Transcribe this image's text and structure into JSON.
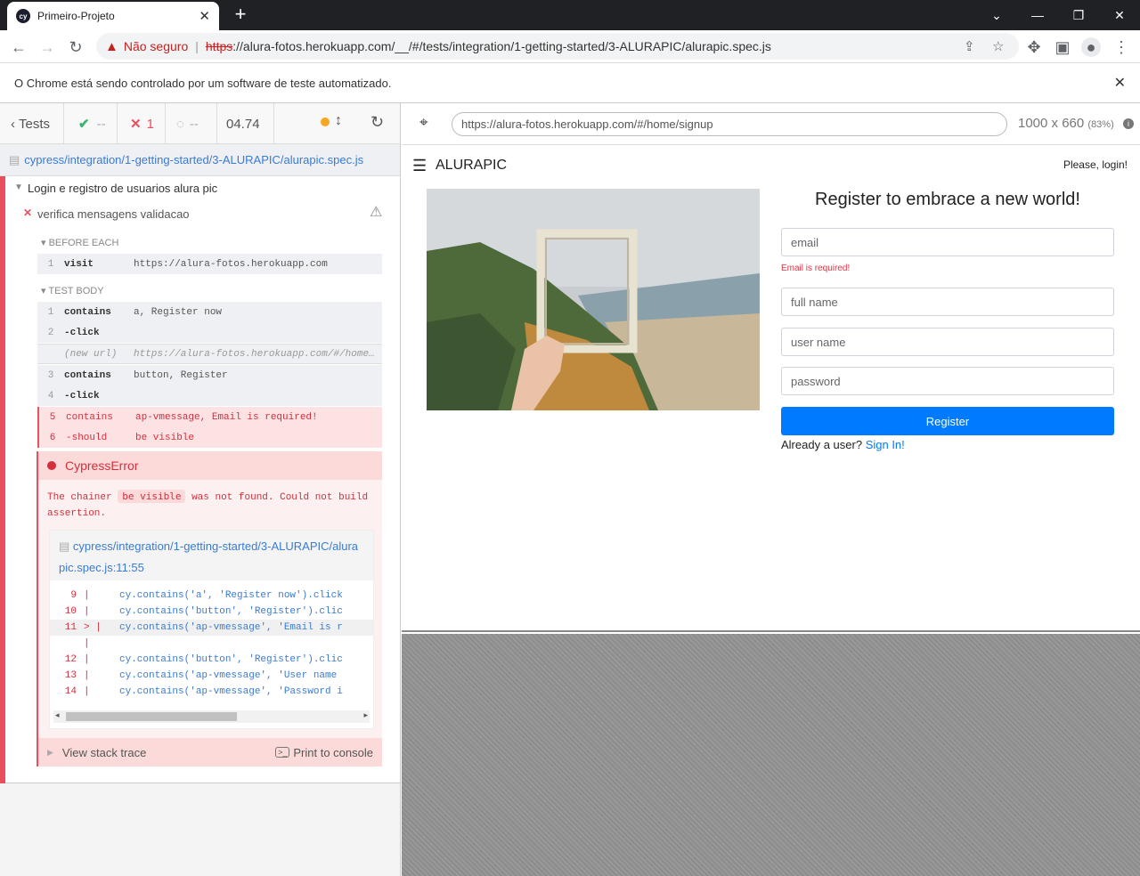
{
  "browser": {
    "tab_title": "Primeiro-Projeto",
    "favicon_text": "cy",
    "not_secure_label": "Não seguro",
    "url_scheme": "https",
    "url_rest": "://alura-fotos.herokuapp.com/__/#/tests/integration/1-getting-started/3-ALURAPIC/alurapic.spec.js",
    "infobar_text": "O Chrome está sendo controlado por um software de teste automatizado."
  },
  "reporter": {
    "tests_label": "Tests",
    "passed": "--",
    "failed": "1",
    "pending": "--",
    "duration": "04.74",
    "spec_path": "cypress/integration/1-getting-started/3-ALURAPIC/alurapic.spec.js",
    "suite_title": "Login e registro de usuarios alura pic",
    "test_title": "verifica mensagens validacao",
    "before_each_label": "BEFORE EACH",
    "test_body_label": "TEST BODY",
    "before_each_commands": [
      {
        "n": "1",
        "name": "visit",
        "msg": "https://alura-fotos.herokuapp.com"
      }
    ],
    "commands": [
      {
        "n": "1",
        "name": "contains",
        "msg": "a, Register now"
      },
      {
        "n": "2",
        "name": "-click",
        "msg": ""
      },
      {
        "n": "",
        "name": "(new url)",
        "msg": "https://alura-fotos.herokuapp.com/#/home/signup"
      },
      {
        "n": "3",
        "name": "contains",
        "msg": "button, Register"
      },
      {
        "n": "4",
        "name": "-click",
        "msg": ""
      },
      {
        "n": "5",
        "name": "contains",
        "msg": "ap-vmessage, Email is required!"
      },
      {
        "n": "6",
        "name": "-should",
        "msg": "be visible"
      }
    ],
    "error": {
      "title": "CypressError",
      "message_pre": "The chainer",
      "message_code": "be visible",
      "message_post": "was not found. Could not build assertion.",
      "file_link": "cypress/integration/1-getting-started/3-ALURAPIC/alurapic.spec.js:11:55",
      "code_lines": [
        {
          "ln": "9",
          "marker": "|",
          "code": "cy.contains('a', 'Register now').click"
        },
        {
          "ln": "10",
          "marker": "|",
          "code": "cy.contains('button', 'Register').clic"
        },
        {
          "ln": "11",
          "marker": "> |",
          "code": "cy.contains('ap-vmessage', 'Email is r"
        },
        {
          "ln": "",
          "marker": "|",
          "code": ""
        },
        {
          "ln": "12",
          "marker": "|",
          "code": "cy.contains('button', 'Register').clic"
        },
        {
          "ln": "13",
          "marker": "|",
          "code": "cy.contains('ap-vmessage', 'User name"
        },
        {
          "ln": "14",
          "marker": "|",
          "code": "cy.contains('ap-vmessage', 'Password i"
        }
      ],
      "stack_trace_label": "View stack trace",
      "print_console_label": "Print to console"
    }
  },
  "aut_header": {
    "url": "https://alura-fotos.herokuapp.com/#/home/signup",
    "viewport": "1000 x 660",
    "scale": "(83%)"
  },
  "app": {
    "brand": "ALURAPIC",
    "login_prompt": "Please, login!",
    "heading": "Register to embrace a new world!",
    "email_placeholder": "email",
    "email_error": "Email is required!",
    "fullname_placeholder": "full name",
    "username_placeholder": "user name",
    "password_placeholder": "password",
    "register_button": "Register",
    "already_user": "Already a user?",
    "sign_in_link": "Sign In!"
  },
  "colors": {
    "fail_red": "#e94f5f",
    "link_blue": "#3a7bd5",
    "primary_button": "#007bff"
  }
}
